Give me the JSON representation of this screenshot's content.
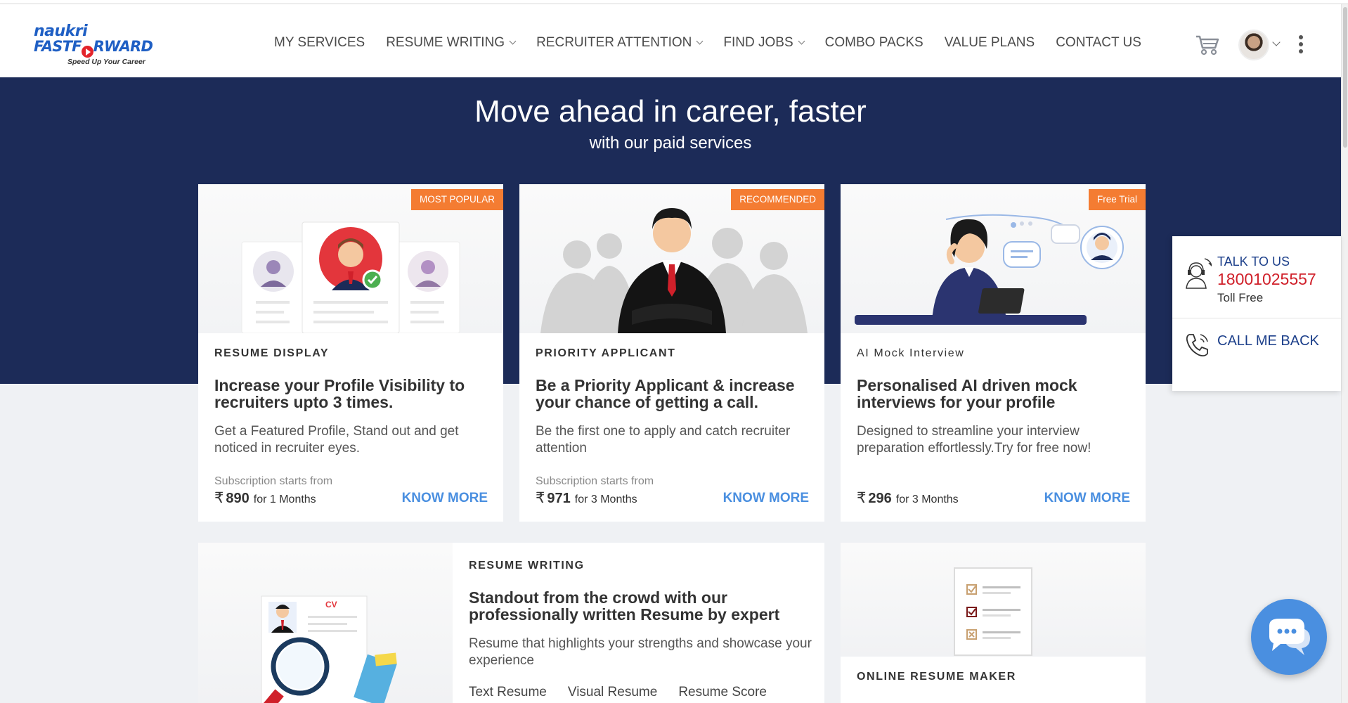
{
  "header": {
    "logo": {
      "line1": "naukri",
      "line2_a": "FASTF",
      "line2_b": "RWARD",
      "tagline": "Speed Up Your Career"
    },
    "nav": [
      {
        "label": "MY SERVICES",
        "dropdown": false
      },
      {
        "label": "RESUME WRITING",
        "dropdown": true
      },
      {
        "label": "RECRUITER ATTENTION",
        "dropdown": true
      },
      {
        "label": "FIND JOBS",
        "dropdown": true
      },
      {
        "label": "COMBO PACKS",
        "dropdown": false
      },
      {
        "label": "VALUE PLANS",
        "dropdown": false
      },
      {
        "label": "CONTACT US",
        "dropdown": false
      }
    ],
    "icons": [
      "cart-icon",
      "avatar",
      "kebab-menu-icon"
    ]
  },
  "hero": {
    "title": "Move ahead in career, faster",
    "subtitle": "with our paid services"
  },
  "cards": [
    {
      "badge": "MOST POPULAR",
      "tag": "RESUME DISPLAY",
      "heading": "Increase your Profile Visibility to recruiters upto 3 times.",
      "description": "Get a Featured Profile, Stand out and get noticed in recruiter eyes.",
      "subscription": "Subscription starts from",
      "currency": "₹",
      "price": "890",
      "duration": "for 1 Months",
      "cta": "KNOW MORE"
    },
    {
      "badge": "RECOMMENDED",
      "tag": "PRIORITY APPLICANT",
      "heading": "Be a Priority Applicant & increase your chance of getting a call.",
      "description": "Be the first one to apply and catch recruiter attention",
      "subscription": "Subscription starts from",
      "currency": "₹",
      "price": "971",
      "duration": "for 3 Months",
      "cta": "KNOW MORE"
    },
    {
      "badge": "Free Trial",
      "tag": "AI Mock Interview",
      "heading": "Personalised AI driven mock interviews for your profile",
      "description": "Designed to streamline your interview preparation effortlessly.Try for free now!",
      "subscription": "",
      "currency": "₹",
      "price": "296",
      "duration": "for 3 Months",
      "cta": "KNOW MORE"
    }
  ],
  "resume_writing": {
    "tag": "RESUME WRITING",
    "heading": "Standout from the crowd with our professionally written Resume by expert",
    "description": "Resume that highlights your strengths and showcase your experience",
    "links": [
      "Text Resume",
      "Visual Resume",
      "Resume Score"
    ],
    "cv_label": "CV"
  },
  "resume_maker": {
    "tag": "ONLINE RESUME MAKER"
  },
  "side_widget": {
    "talk": "TALK TO US",
    "phone": "18001025557",
    "toll": "Toll Free",
    "callback": "CALL ME BACK"
  },
  "colors": {
    "hero_bg": "#1c2b58",
    "badge": "#f47c32",
    "link": "#4a8fe0",
    "brand_blue": "#1f5fc4",
    "phone_red": "#d0202a"
  }
}
